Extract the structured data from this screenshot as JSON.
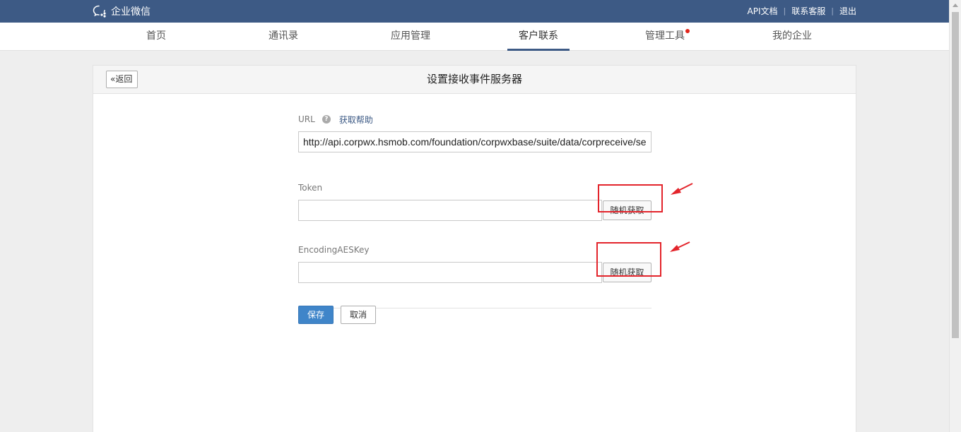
{
  "header": {
    "brand": "企业微信",
    "links": [
      "API文档",
      "联系客服",
      "退出"
    ],
    "separator": "|"
  },
  "nav": {
    "items": [
      {
        "label": "首页"
      },
      {
        "label": "通讯录"
      },
      {
        "label": "应用管理"
      },
      {
        "label": "客户联系",
        "active": true
      },
      {
        "label": "管理工具",
        "dot": true
      },
      {
        "label": "我的企业"
      }
    ]
  },
  "panel": {
    "back_label": "返回",
    "title": "设置接收事件服务器"
  },
  "form": {
    "url_label": "URL",
    "help_icon": "?",
    "help_link": "获取帮助",
    "url_value": "http://api.corpwx.hsmob.com/foundation/corpwxbase/suite/data/corpreceive/se",
    "token_label": "Token",
    "token_value": "",
    "aes_label": "EncodingAESKey",
    "aes_value": "",
    "random_label": "随机获取",
    "save_label": "保存",
    "cancel_label": "取消"
  },
  "annotations": {
    "highlight_color": "#e3242b"
  },
  "colors": {
    "topbar": "#3d5a85",
    "primary_button": "#3f85c9"
  }
}
